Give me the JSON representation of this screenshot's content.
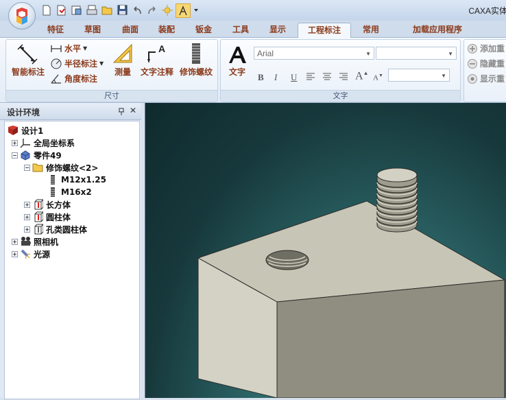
{
  "window": {
    "title": "CAXA实体"
  },
  "quick_access": {
    "icons": [
      "new-doc-icon",
      "open-red-icon",
      "export-icon",
      "print-icon",
      "folder-open-icon",
      "save-icon",
      "undo-icon",
      "redo-icon",
      "sun-icon",
      "highlight-tool-icon",
      "customize-arrow-icon"
    ]
  },
  "tabs": [
    {
      "label": "特征"
    },
    {
      "label": "草图"
    },
    {
      "label": "曲面"
    },
    {
      "label": "装配"
    },
    {
      "label": "钣金"
    },
    {
      "label": "工具"
    },
    {
      "label": "显示"
    },
    {
      "label": "工程标注",
      "active": true
    },
    {
      "label": "常用"
    },
    {
      "label": "加载应用程序"
    }
  ],
  "ribbon": {
    "dimension_group": {
      "label": "尺寸",
      "smart_dim": "智能标注",
      "horizontal": "水平",
      "radius": "半径标注",
      "angle": "角度标注",
      "measure": "测量",
      "text_annotation": "文字注释",
      "thread": "修饰螺纹"
    },
    "text_group": {
      "label": "文字",
      "text_button": "文字",
      "font": "Arial",
      "font_size": "",
      "style": "",
      "bold": "B",
      "italic": "I",
      "underline": "U",
      "grow": "A",
      "shrink": "A"
    },
    "right_group": {
      "add": "添加重",
      "hide": "隐藏重",
      "show": "显示重"
    }
  },
  "panel": {
    "title": "设计环境",
    "pin": "ꟷ",
    "close": "✕"
  },
  "tree": {
    "root": "设计1",
    "global_coords": "全局坐标系",
    "part": "零件49",
    "thread_folder": "修饰螺纹<2>",
    "thread1": "M12x1.25",
    "thread2": "M16x2",
    "box": "长方体",
    "cylinder": "圆柱体",
    "hole_cylinder": "孔类圆柱体",
    "camera": "照相机",
    "light": "光源"
  },
  "colors": {
    "accent_text": "#8b3a1a",
    "viewport_bg": "#17393c",
    "part_face": "#c9c8b8"
  }
}
